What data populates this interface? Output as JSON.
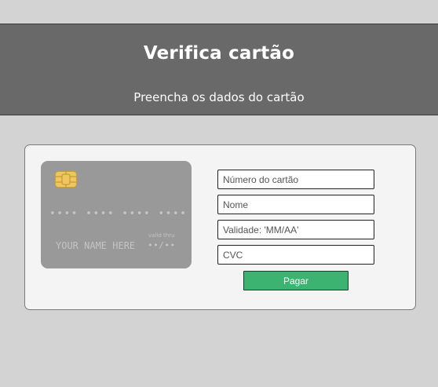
{
  "header": {
    "title": "Verifica cartão",
    "subtitle": "Preencha os dados do cartão"
  },
  "card": {
    "number_mask": "•••• •••• •••• ••••",
    "valid_label": "valid thru",
    "name_placeholder": "YOUR NAME HERE",
    "expiry_mask": "••/••",
    "chip_icon": "card-chip-icon"
  },
  "form": {
    "card_number_placeholder": "Número do cartão",
    "name_placeholder": "Nome",
    "expiry_placeholder": "Validade: 'MM/AA'",
    "cvc_placeholder": "CVC",
    "submit_label": "Pagar"
  },
  "colors": {
    "background": "#d3d3d3",
    "header": "#696969",
    "card": "#999999",
    "button": "#3cb371",
    "chip": "#f0c75e"
  }
}
